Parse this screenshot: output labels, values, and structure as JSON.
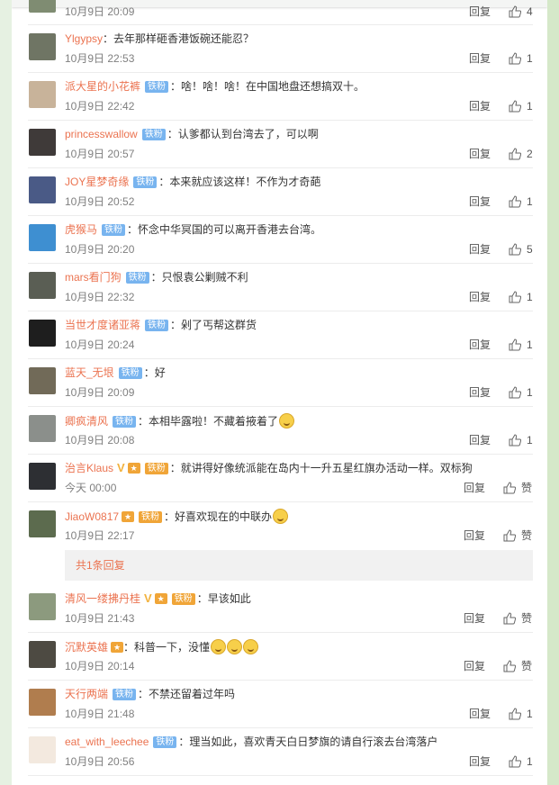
{
  "ui": {
    "reply_label": "回复",
    "like_word": "赞"
  },
  "top_partial": {
    "time": "10月9日 20:09",
    "likes": "4"
  },
  "comments": [
    {
      "name": "Ylgypsy",
      "badge": "",
      "text": "：去年那样砸香港饭碗还能忍？",
      "time": "10月9日 22:53",
      "likes": "1"
    },
    {
      "name": "派大星的小花裤",
      "badge": "铁粉",
      "text": "：啥！啥！啥！在中国地盘还想搞双十。",
      "time": "10月9日 22:42",
      "likes": "1"
    },
    {
      "name": "princesswallow",
      "badge": "铁粉",
      "text": "：认爹都认到台湾去了，可以啊",
      "time": "10月9日 20:57",
      "likes": "2"
    },
    {
      "name": "JOY星梦奇缘",
      "badge": "铁粉",
      "text": "：本来就应该这样！不作为才奇葩",
      "time": "10月9日 20:52",
      "likes": "1"
    },
    {
      "name": "虎猴马",
      "badge": "铁粉",
      "text": "：怀念中华冥国的可以离开香港去台湾。",
      "time": "10月9日 20:20",
      "likes": "5"
    },
    {
      "name": "mars看门狗",
      "badge": "铁粉",
      "text": "：只恨袁公剿贼不利",
      "time": "10月9日 22:32",
      "likes": "1"
    },
    {
      "name": "当世才度诸亚蒋",
      "badge": "铁粉",
      "text": "：剁了丐帮这群货",
      "time": "10月9日 20:24",
      "likes": "1"
    },
    {
      "name": "蓝天_无垠",
      "badge": "铁粉",
      "text": "：好",
      "time": "10月9日 20:09",
      "likes": "1"
    },
    {
      "name": "卿疯清风",
      "badge": "铁粉",
      "text": "：本相毕露啦！不藏着掖着了",
      "time": "10月9日 20:08",
      "likes": "1"
    },
    {
      "name": "治言Klaus",
      "badge": "铁粉",
      "text": "：就讲得好像统派能在岛内十一升五星红旗办活动一样。双标狗",
      "time": "今天 00:00",
      "likes": "赞"
    },
    {
      "name": "JiaoW0817",
      "badge": "铁粉",
      "text": "：好喜欢现在的中联办",
      "time": "10月9日 22:17",
      "likes": "赞"
    },
    {
      "name": "清风一缕拂丹桂",
      "badge": "铁粉",
      "text": "：早该如此",
      "time": "10月9日 21:43",
      "likes": "赞"
    },
    {
      "name": "沉默英雄",
      "badge": "",
      "text": "：科普一下，没懂",
      "time": "10月9日 20:14",
      "likes": "赞"
    },
    {
      "name": "天行两端",
      "badge": "铁粉",
      "text": "：不禁还留着过年吗",
      "time": "10月9日 21:48",
      "likes": "1"
    },
    {
      "name": "eat_with_leechee",
      "badge": "铁粉",
      "text": "：理当如此，喜欢青天白日梦旗的请自行滚去台湾落户",
      "time": "10月9日 20:56",
      "likes": "1"
    }
  ],
  "more_replies": "共1条回复"
}
